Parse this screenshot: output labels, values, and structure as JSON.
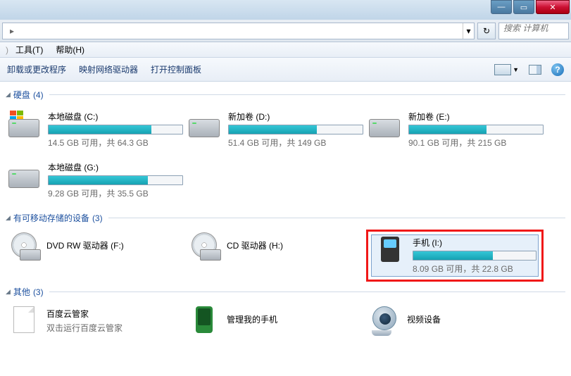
{
  "window": {
    "min": "—",
    "max": "▭",
    "close": "✕"
  },
  "address": {
    "dropdown": "▾",
    "refresh": "↻"
  },
  "search": {
    "placeholder": "搜索 计算机"
  },
  "menu": {
    "tools": "工具(T)",
    "help": "帮助(H)"
  },
  "toolbar": {
    "uninstall": "卸载或更改程序",
    "map": "映射网络驱动器",
    "cp": "打开控制面板"
  },
  "groups": {
    "hdd": {
      "label": "硬盘",
      "count": "(4)"
    },
    "removable": {
      "label": "有可移动存储的设备",
      "count": "(3)"
    },
    "other": {
      "label": "其他",
      "count": "(3)"
    }
  },
  "drives": {
    "c": {
      "name": "本地磁盘 (C:)",
      "sub": "14.5 GB 可用，共 64.3 GB",
      "pct": 77
    },
    "d": {
      "name": "新加卷 (D:)",
      "sub": "51.4 GB 可用，共 149 GB",
      "pct": 66
    },
    "e": {
      "name": "新加卷 (E:)",
      "sub": "90.1 GB 可用，共 215 GB",
      "pct": 58
    },
    "g": {
      "name": "本地磁盘 (G:)",
      "sub": "9.28 GB 可用，共 35.5 GB",
      "pct": 74
    },
    "i": {
      "name": "手机 (I:)",
      "sub": "8.09 GB 可用，共 22.8 GB",
      "pct": 65
    }
  },
  "removables": {
    "dvd": "DVD RW 驱动器 (F:)",
    "cd": "CD 驱动器 (H:)"
  },
  "others": {
    "baidu": {
      "name": "百度云管家",
      "sub": "双击运行百度云管家"
    },
    "phone": "管理我的手机",
    "video": "视频设备"
  }
}
